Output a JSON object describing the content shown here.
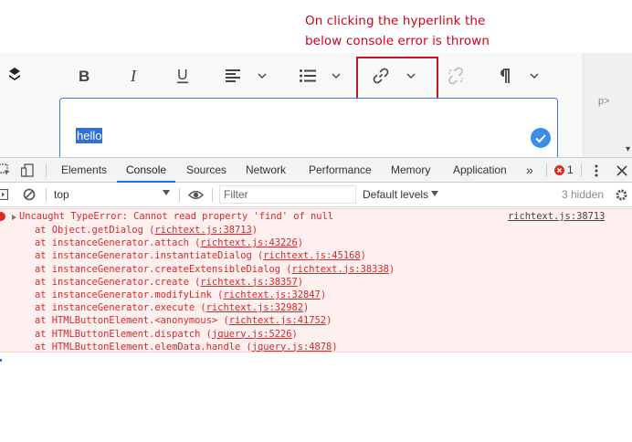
{
  "annotation": {
    "line1": "On clicking the hyperlink the",
    "line2": "below console error is thrown"
  },
  "editor": {
    "text": "hello",
    "right_panel_text": "p>",
    "toolbar": [
      "bold-icon",
      "italic-icon",
      "underline-icon",
      "align-icon",
      "list-icon",
      "link-icon",
      "unlink-icon",
      "paragraph-icon"
    ]
  },
  "devtools": {
    "tabs": [
      "Elements",
      "Console",
      "Sources",
      "Network",
      "Performance",
      "Memory",
      "Application"
    ],
    "active_tab": "Console",
    "more": "»",
    "error_count": "1",
    "accent": "#1a73e8"
  },
  "console": {
    "context": "top",
    "filter_placeholder": "Filter",
    "levels": "Default levels",
    "hidden": "3 hidden",
    "error": {
      "message": "Uncaught TypeError: Cannot read property 'find' of null",
      "source": "richtext.js:38713",
      "stack": [
        {
          "text": "at Object.getDialog (",
          "loc": "richtext.js:38713",
          "end": ")"
        },
        {
          "text": "at instanceGenerator.attach (",
          "loc": "richtext.js:43226",
          "end": ")"
        },
        {
          "text": "at instanceGenerator.instantiateDialog (",
          "loc": "richtext.js:45168",
          "end": ")"
        },
        {
          "text": "at instanceGenerator.createExtensibleDialog (",
          "loc": "richtext.js:38338",
          "end": ")"
        },
        {
          "text": "at instanceGenerator.create (",
          "loc": "richtext.js:38357",
          "end": ")"
        },
        {
          "text": "at instanceGenerator.modifyLink (",
          "loc": "richtext.js:32847",
          "end": ")"
        },
        {
          "text": "at instanceGenerator.execute (",
          "loc": "richtext.js:32982",
          "end": ")"
        },
        {
          "text": "at HTMLButtonElement.<anonymous> (",
          "loc": "richtext.js:41752",
          "end": ")"
        },
        {
          "text": "at HTMLButtonElement.dispatch (",
          "loc": "jquery.js:5226",
          "end": ")"
        },
        {
          "text": "at HTMLButtonElement.elemData.handle (",
          "loc": "jquery.js:4878",
          "end": ")"
        }
      ],
      "color": "#d42a2a"
    }
  }
}
